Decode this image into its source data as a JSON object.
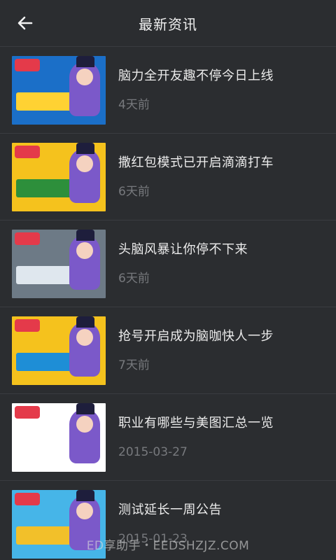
{
  "header": {
    "title": "最新资讯",
    "back_icon": "arrow-left-icon"
  },
  "colors": {
    "background": "#2b2d30",
    "title_text": "#ececec",
    "date_text": "#77797d",
    "divider": "#3a3c40"
  },
  "news": [
    {
      "title": "脑力全开友趣不停今日上线",
      "date": "4天前",
      "thumb_bg": "#1b6fc8",
      "banner": "#ffd233"
    },
    {
      "title": "撒红包模式已开启滴滴打车",
      "date": "6天前",
      "thumb_bg": "#f5c21d",
      "banner": "#2d8f3b"
    },
    {
      "title": "头脑风暴让你停不下来",
      "date": "6天前",
      "thumb_bg": "#6d7a86",
      "banner": "#dfe7ee"
    },
    {
      "title": "抢号开启成为脑咖快人一步",
      "date": "7天前",
      "thumb_bg": "#f5c21d",
      "banner": "#1e8ed6"
    },
    {
      "title": "职业有哪些与美图汇总一览",
      "date": "2015-03-27",
      "thumb_bg": "#ffffff",
      "banner": "#ffffff"
    },
    {
      "title": "测试延长一周公告",
      "date": "2015-01-23",
      "thumb_bg": "#46b5e8",
      "banner": "#f2c02a"
    }
  ],
  "watermark": "ED享助手・EEDSHZJZ.COM"
}
